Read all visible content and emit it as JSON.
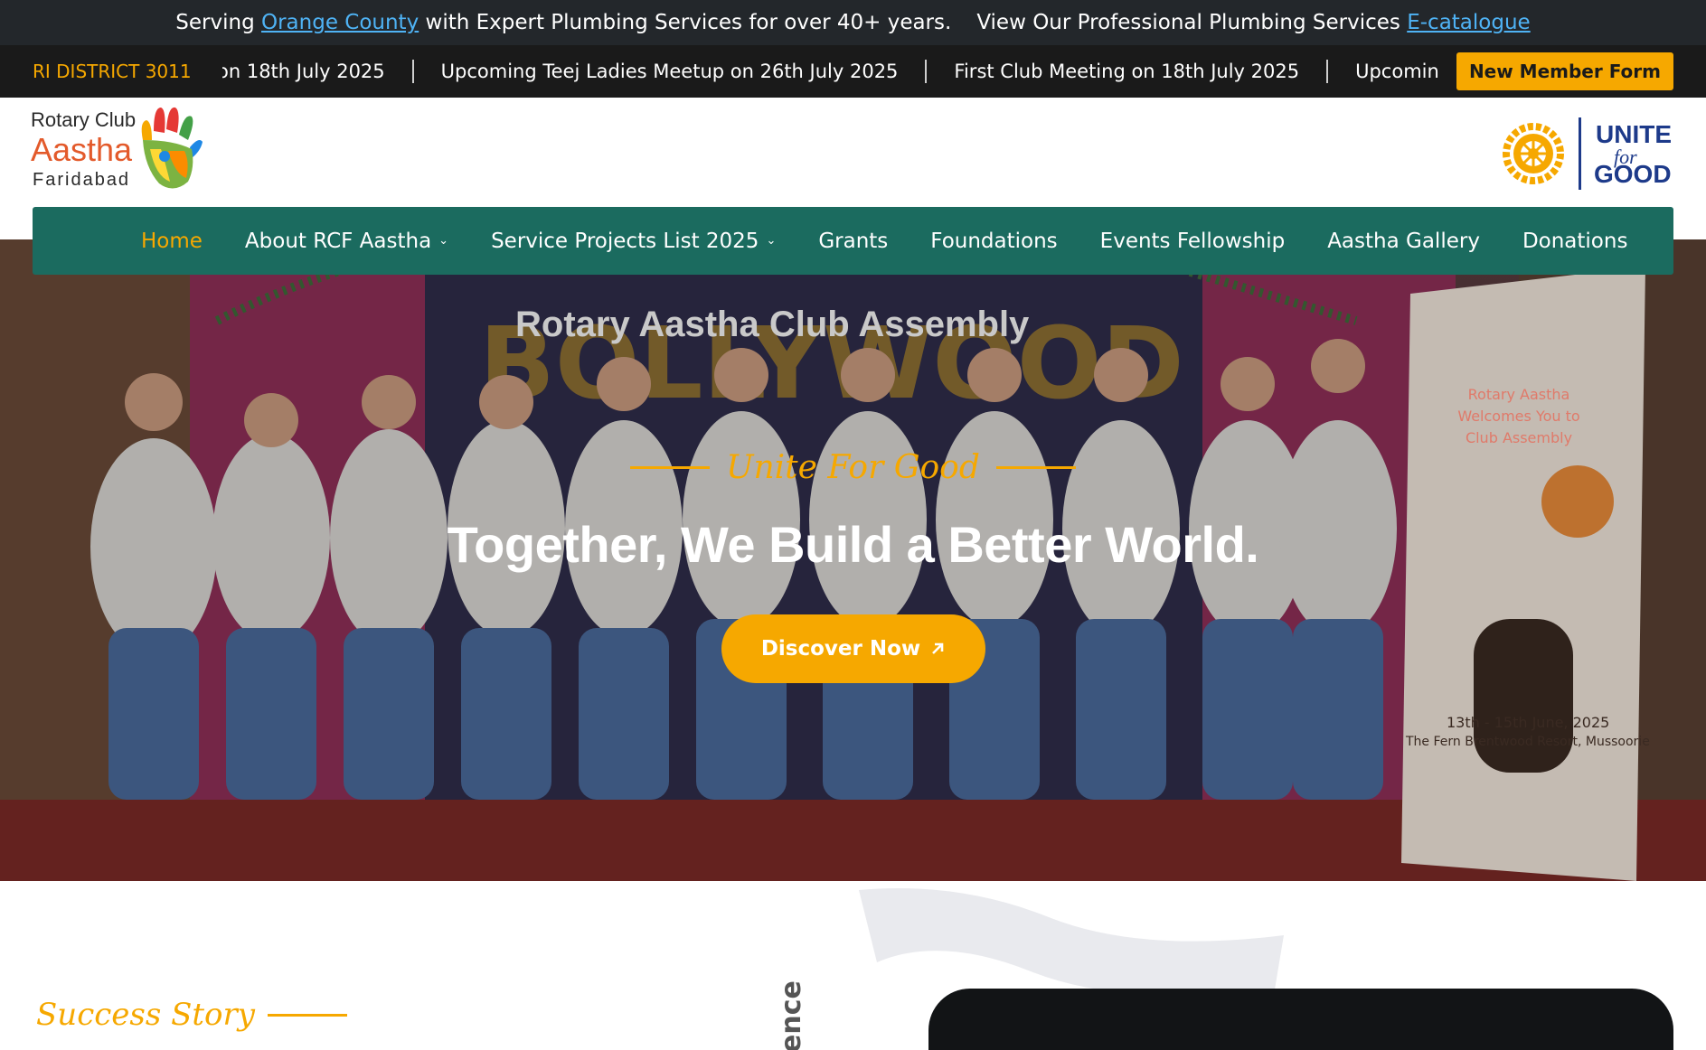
{
  "promo": {
    "serving": "Serving",
    "location_link": "Orange County",
    "serving_rest": "with Expert Plumbing Services for over 40+ years.",
    "view_text": "View Our Professional Plumbing Services",
    "catalogue_link": "E-catalogue"
  },
  "ticker": {
    "district": "RI DISTRICT 3011",
    "items": [
      "on 18th July 2025",
      "Upcoming Teej Ladies Meetup on 26th July 2025",
      "First Club Meeting on 18th July 2025",
      "Upcoming Teej L"
    ],
    "member_button": "New Member Form"
  },
  "logo_left": {
    "line1": "Rotary Club",
    "line2": "Aastha",
    "line3": "Faridabad"
  },
  "logo_right": {
    "line1": "UNITE",
    "line2": "for",
    "line3": "GOOD"
  },
  "nav": {
    "items": [
      {
        "label": "Home",
        "active": true
      },
      {
        "label": "About RCF Aastha",
        "dropdown": true
      },
      {
        "label": "Service Projects List 2025",
        "dropdown": true
      },
      {
        "label": "Grants"
      },
      {
        "label": "Foundations"
      },
      {
        "label": "Events Fellowship"
      },
      {
        "label": "Aastha Gallery"
      },
      {
        "label": "Donations"
      }
    ]
  },
  "hero": {
    "banner_text": "Rotary Aastha Club Assembly",
    "tagline": "Unite For Good",
    "title": "Together, We Build a Better World.",
    "cta": "Discover Now"
  },
  "standee": {
    "line1": "Rotary Aastha",
    "line2": "Welcomes You to",
    "line3": "Club Assembly",
    "dates": "13th - 15th June, 2025",
    "venue": "The Fern Brentwood Resort, Mussoorie"
  },
  "bottom": {
    "story_label": "Success Story",
    "vertical_text": "ence"
  },
  "colors": {
    "accent": "#f6a800",
    "nav_bg": "#1b6b5f",
    "promo_bg": "#23272b",
    "ticker_bg": "#1a1a1a",
    "link": "#4fb3f5",
    "rotary_blue": "#1d3a8a"
  }
}
